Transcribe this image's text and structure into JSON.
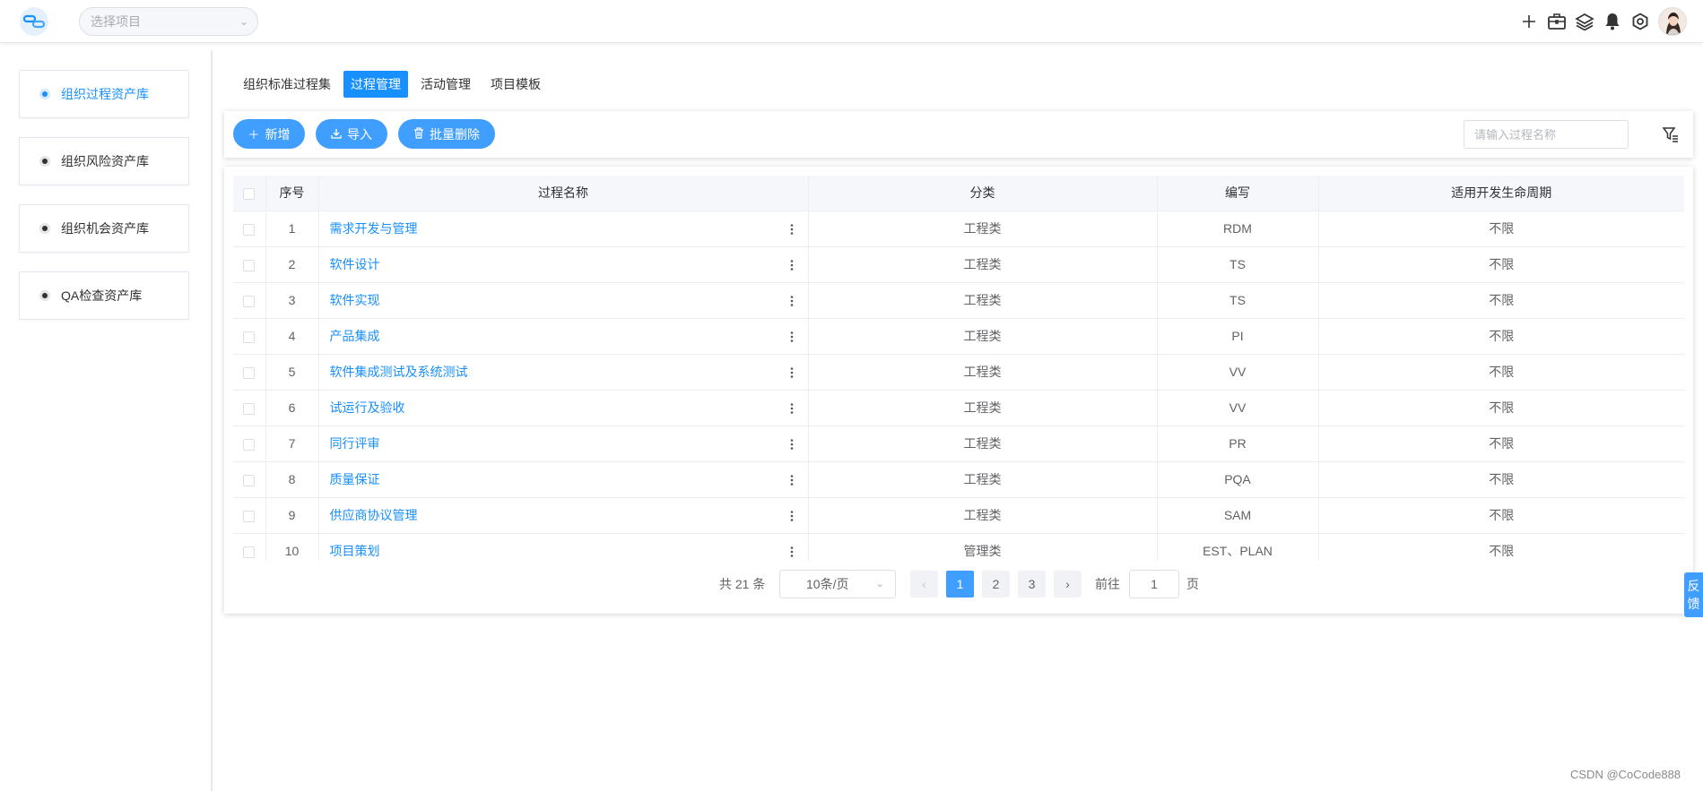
{
  "header": {
    "project_select_placeholder": "选择项目",
    "icons": [
      "plus-icon",
      "toolbox-icon",
      "layers-icon",
      "bell-icon",
      "settings-icon"
    ]
  },
  "sidebar": {
    "items": [
      {
        "label": "组织过程资产库",
        "active": true
      },
      {
        "label": "组织风险资产库",
        "active": false
      },
      {
        "label": "组织机会资产库",
        "active": false
      },
      {
        "label": "QA检查资产库",
        "active": false
      }
    ]
  },
  "tabs": [
    {
      "label": "组织标准过程集",
      "active": false
    },
    {
      "label": "过程管理",
      "active": true
    },
    {
      "label": "活动管理",
      "active": false
    },
    {
      "label": "项目模板",
      "active": false
    }
  ],
  "toolbar": {
    "add_label": "新增",
    "import_label": "导入",
    "batch_delete_label": "批量删除",
    "search_placeholder": "请输入过程名称"
  },
  "table": {
    "columns": [
      "",
      "序号",
      "过程名称",
      "分类",
      "编写",
      "适用开发生命周期"
    ],
    "rows": [
      {
        "index": "1",
        "name": "需求开发与管理",
        "category": "工程类",
        "code": "RDM",
        "lifecycle": "不限"
      },
      {
        "index": "2",
        "name": "软件设计",
        "category": "工程类",
        "code": "TS",
        "lifecycle": "不限"
      },
      {
        "index": "3",
        "name": "软件实现",
        "category": "工程类",
        "code": "TS",
        "lifecycle": "不限"
      },
      {
        "index": "4",
        "name": "产品集成",
        "category": "工程类",
        "code": "PI",
        "lifecycle": "不限"
      },
      {
        "index": "5",
        "name": "软件集成测试及系统测试",
        "category": "工程类",
        "code": "VV",
        "lifecycle": "不限"
      },
      {
        "index": "6",
        "name": "试运行及验收",
        "category": "工程类",
        "code": "VV",
        "lifecycle": "不限"
      },
      {
        "index": "7",
        "name": "同行评审",
        "category": "工程类",
        "code": "PR",
        "lifecycle": "不限"
      },
      {
        "index": "8",
        "name": "质量保证",
        "category": "工程类",
        "code": "PQA",
        "lifecycle": "不限"
      },
      {
        "index": "9",
        "name": "供应商协议管理",
        "category": "工程类",
        "code": "SAM",
        "lifecycle": "不限"
      },
      {
        "index": "10",
        "name": "项目策划",
        "category": "管理类",
        "code": "EST、PLAN",
        "lifecycle": "不限"
      }
    ]
  },
  "pagination": {
    "total_text": "共 21 条",
    "page_size": "10条/页",
    "pages": [
      "1",
      "2",
      "3"
    ],
    "current_page": "1",
    "goto_label": "前往",
    "goto_value": "1",
    "page_suffix": "页"
  },
  "feedback": {
    "chars": [
      "反",
      "馈"
    ]
  },
  "watermark": "CSDN @CoCode888",
  "colors": {
    "accent": "#1890ff",
    "button": "#409eff",
    "border": "#ebeef5"
  }
}
